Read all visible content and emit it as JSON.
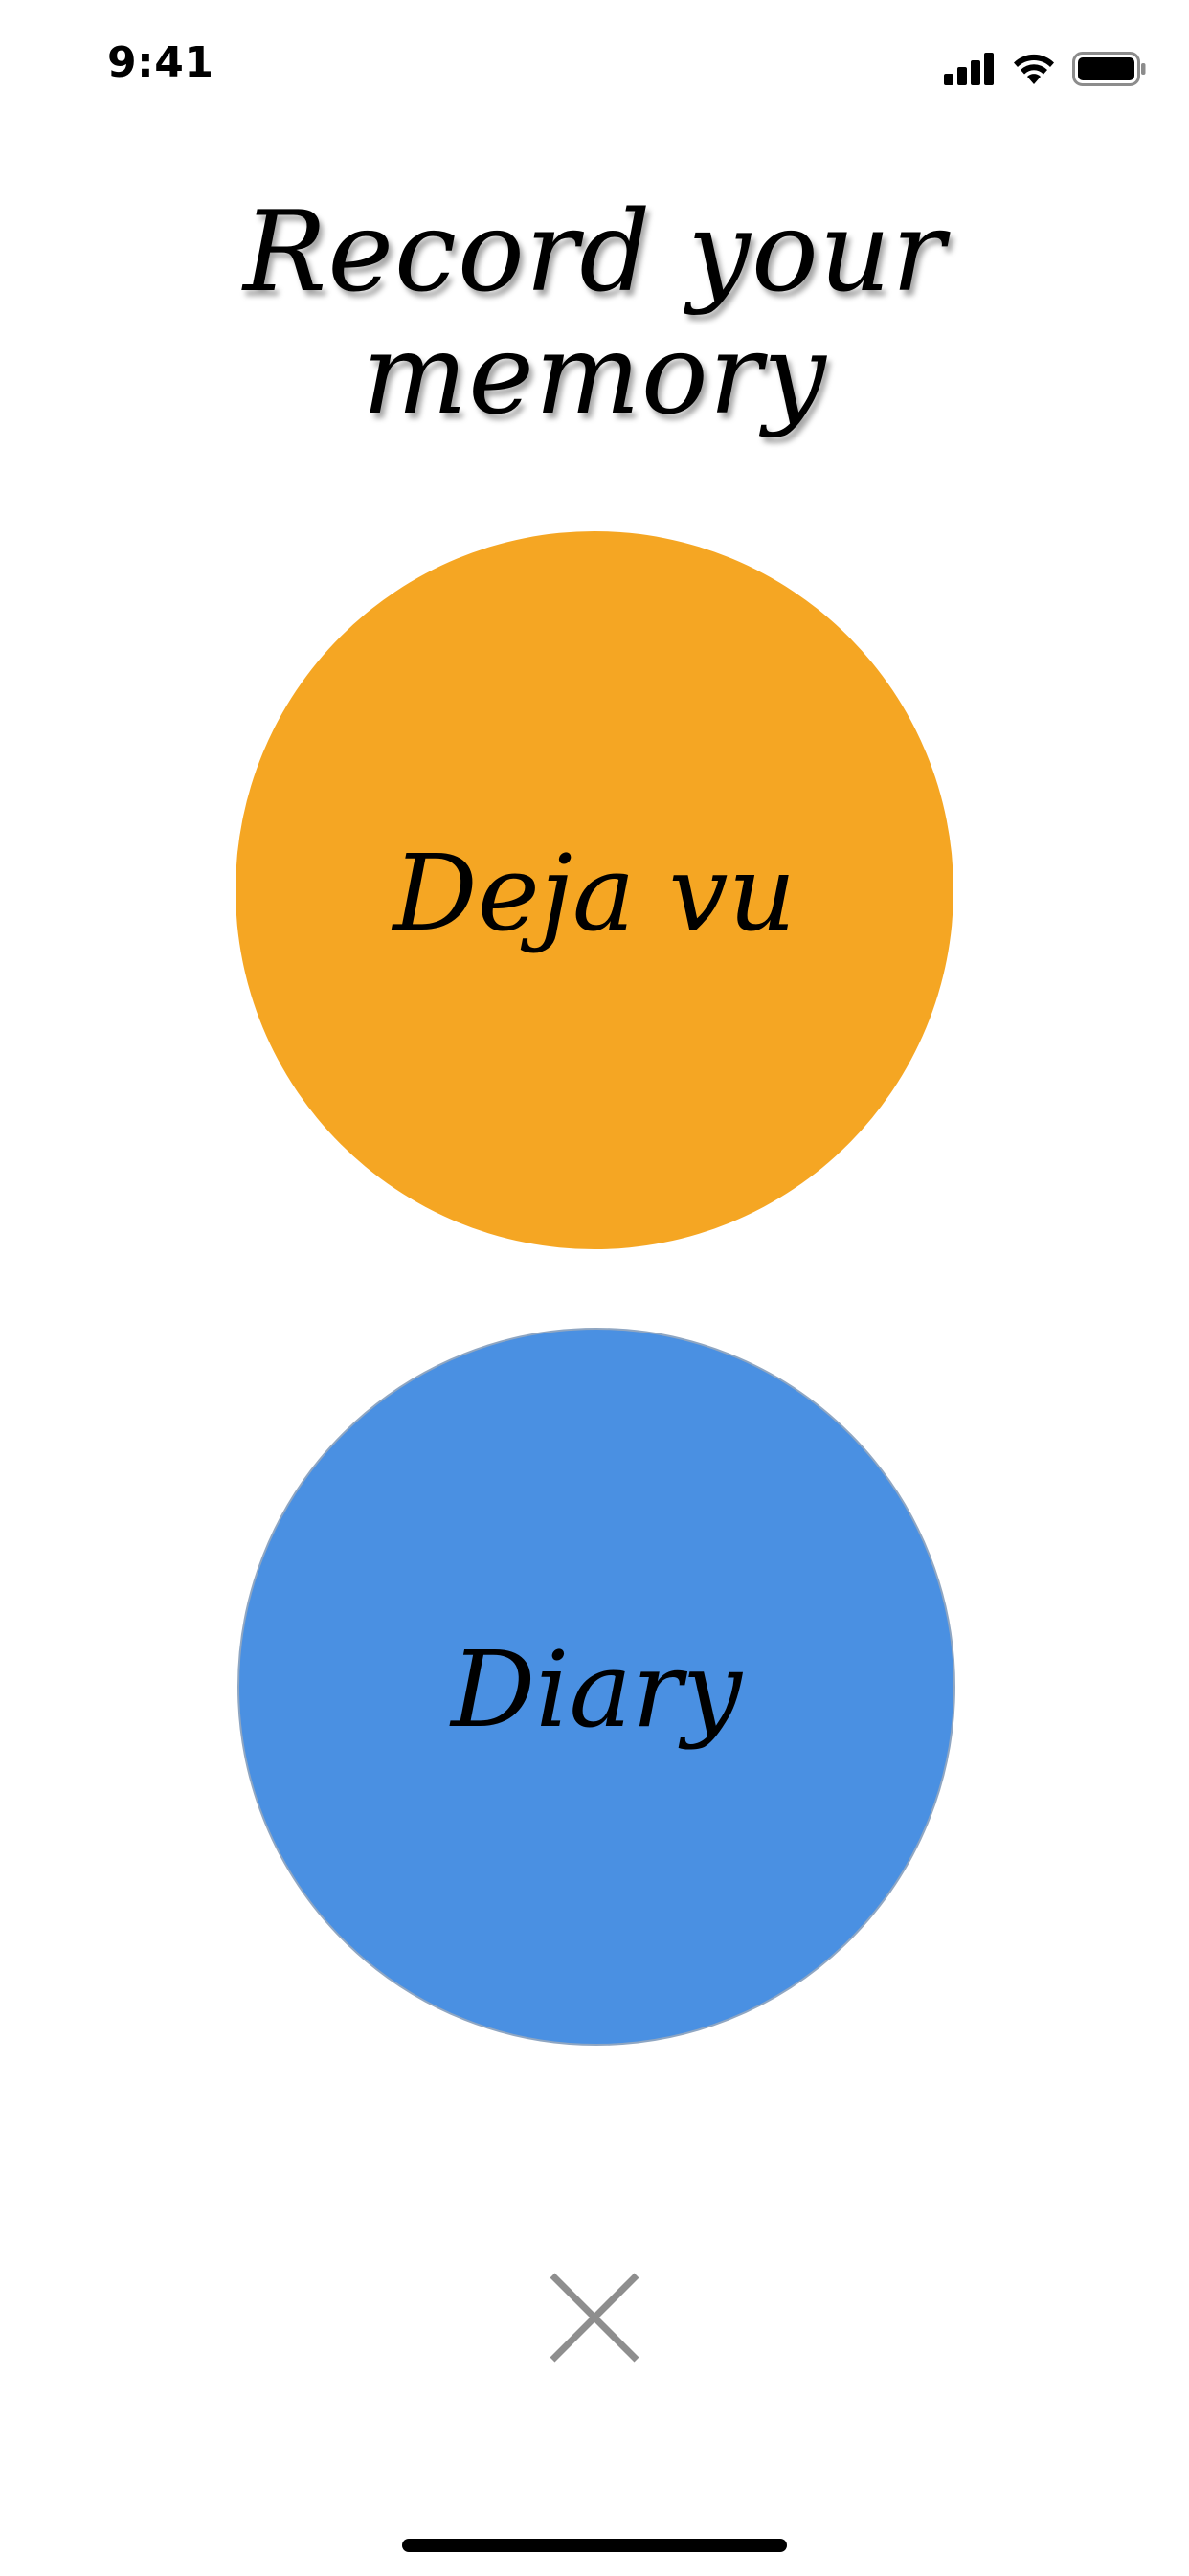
{
  "status_bar": {
    "time": "9:41",
    "icons": [
      "cellular-signal-icon",
      "wifi-icon",
      "battery-icon"
    ]
  },
  "header": {
    "title": "Record your memory"
  },
  "options": [
    {
      "label": "Deja vu",
      "color": "#F5A623"
    },
    {
      "label": "Diary",
      "color": "#4A90E2"
    }
  ],
  "close": {
    "icon": "close-icon",
    "color": "#8E8E8E"
  }
}
